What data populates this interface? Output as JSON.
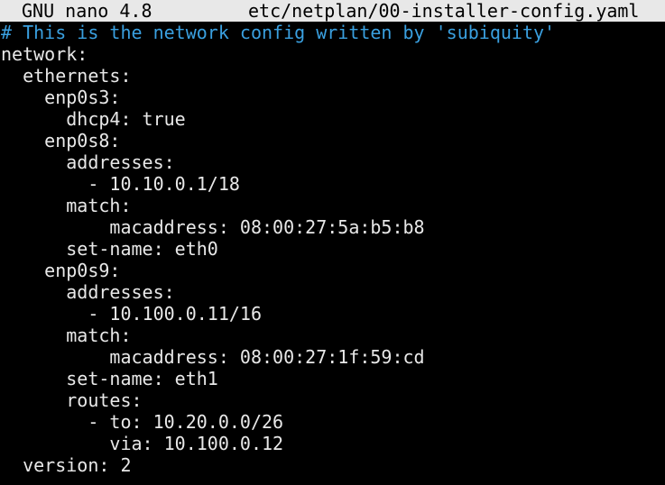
{
  "titlebar": {
    "app": "GNU nano 4.8",
    "filename": "etc/netplan/00-installer-config.yaml"
  },
  "colors": {
    "background": "#000000",
    "text": "#e8e8e8",
    "titlebar_bg": "#e8e8e8",
    "titlebar_fg": "#000000",
    "comment": "#3aa0e0"
  },
  "editor": {
    "lines": [
      "# This is the network config written by 'subiquity'",
      "network:",
      "  ethernets:",
      "    enp0s3:",
      "      dhcp4: true",
      "    enp0s8:",
      "      addresses:",
      "        - 10.10.0.1/18",
      "      match:",
      "          macaddress: 08:00:27:5a:b5:b8",
      "      set-name: eth0",
      "    enp0s9:",
      "      addresses:",
      "        - 10.100.0.11/16",
      "      match:",
      "          macaddress: 08:00:27:1f:59:cd",
      "      set-name: eth1",
      "      routes:",
      "        - to: 10.20.0.0/26",
      "          via: 10.100.0.12",
      "  version: 2"
    ]
  }
}
